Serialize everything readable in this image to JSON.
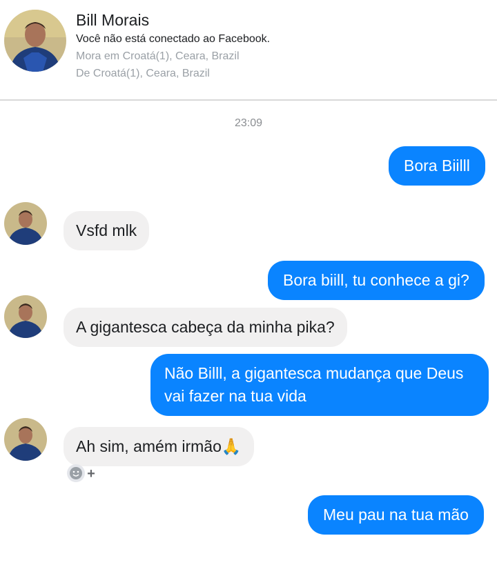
{
  "header": {
    "name": "Bill Morais",
    "status": "Você não está conectado ao Facebook.",
    "lives_in": "Mora em Croatá(1), Ceara, Brazil",
    "from": "De Croatá(1), Ceara, Brazil"
  },
  "timestamp": "23:09",
  "messages": [
    {
      "text": "Bora Biilll"
    },
    {
      "text": "Vsfd mlk"
    },
    {
      "text": "Bora biill, tu conhece a gi?"
    },
    {
      "text": "A gigantesca cabeça da minha pika?"
    },
    {
      "text": "Não Billl, a gigantesca mudança que Deus vai fazer na tua vida"
    },
    {
      "text": "Ah sim, amém irmão🙏"
    },
    {
      "text": "Meu pau na tua mão"
    }
  ],
  "reaction": {
    "plus": "+",
    "icon": "smiley-icon"
  },
  "colors": {
    "outgoing": "#0a84ff",
    "incoming": "#f1f0f0",
    "muted": "#9aa0a6"
  }
}
